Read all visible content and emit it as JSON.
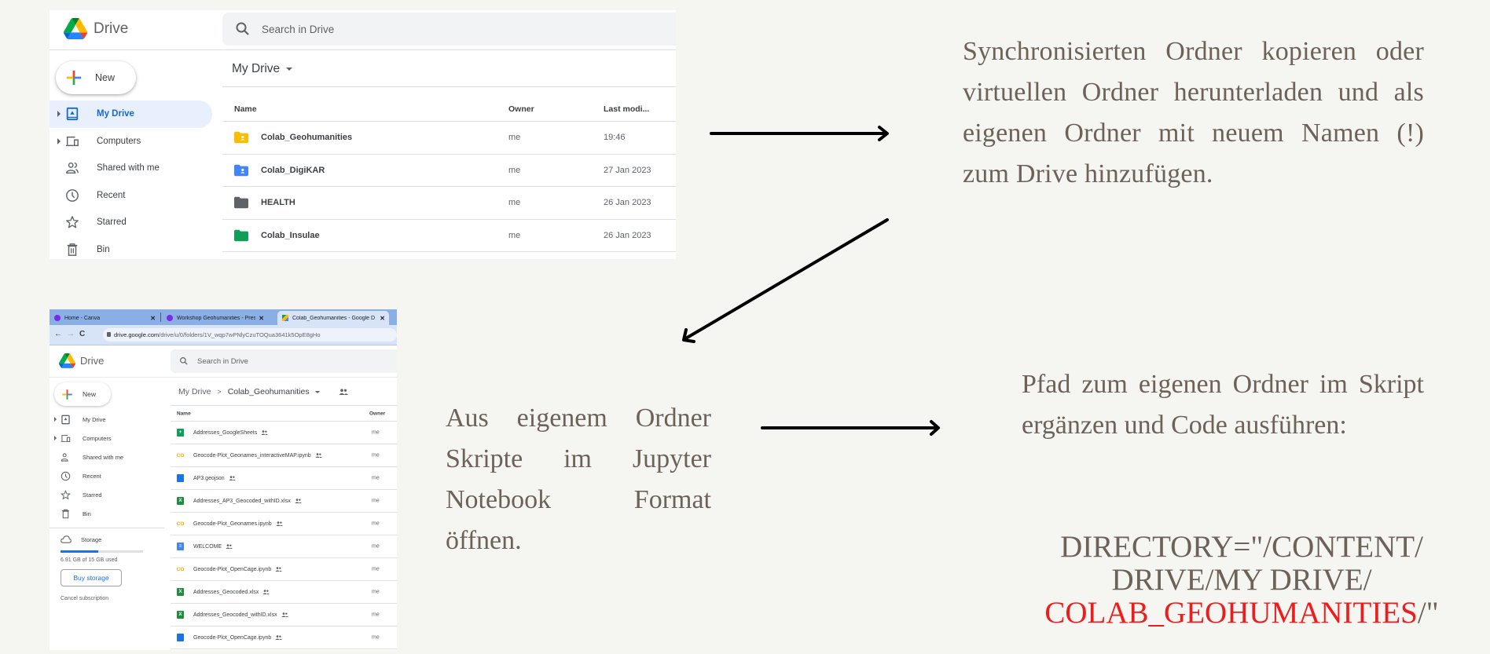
{
  "top_screenshot": {
    "app_name": "Drive",
    "search_placeholder": "Search in Drive",
    "new_label": "New",
    "nav": [
      {
        "label": "My Drive",
        "icon": "my-drive-icon",
        "active": true,
        "expandable": true
      },
      {
        "label": "Computers",
        "icon": "computers-icon",
        "active": false,
        "expandable": true
      },
      {
        "label": "Shared with me",
        "icon": "shared-icon",
        "active": false,
        "expandable": false
      },
      {
        "label": "Recent",
        "icon": "clock-icon",
        "active": false,
        "expandable": false
      },
      {
        "label": "Starred",
        "icon": "star-icon",
        "active": false,
        "expandable": false
      },
      {
        "label": "Bin",
        "icon": "trash-icon",
        "active": false,
        "expandable": false
      }
    ],
    "location": "My Drive",
    "columns": {
      "name": "Name",
      "owner": "Owner",
      "modified": "Last modi..."
    },
    "rows": [
      {
        "name": "Colab_Geohumanities",
        "owner": "me",
        "modified": "19:46",
        "icon": "shared-folder-icon",
        "color": "#fbbc04"
      },
      {
        "name": "Colab_DigiKAR",
        "owner": "me",
        "modified": "27 Jan 2023",
        "icon": "shared-folder-icon",
        "color": "#4285f4"
      },
      {
        "name": "HEALTH",
        "owner": "me",
        "modified": "26 Jan 2023",
        "icon": "folder-icon",
        "color": "#5f6368"
      },
      {
        "name": "Colab_Insulae",
        "owner": "me",
        "modified": "26 Jan 2023",
        "icon": "folder-icon",
        "color": "#0f9d58"
      }
    ]
  },
  "bottom_screenshot": {
    "tabs": [
      {
        "title": "Home - Canva",
        "favicon": "canva-icon",
        "active": false
      },
      {
        "title": "Workshop Geohumanities - Prese",
        "favicon": "canva-icon",
        "active": false
      },
      {
        "title": "Colab_Geohumanities - Google D",
        "favicon": "drive-icon",
        "active": true
      }
    ],
    "url_host": "drive.google.com",
    "url_path": "/drive/u/0/folders/1V_wqp7wPNlyCzuTOQua3641k5OpE8gHo",
    "app_name": "Drive",
    "search_placeholder": "Search in Drive",
    "new_label": "New",
    "nav": [
      {
        "label": "My Drive",
        "expandable": true
      },
      {
        "label": "Computers",
        "expandable": true
      },
      {
        "label": "Shared with me",
        "expandable": false
      },
      {
        "label": "Recent",
        "expandable": false
      },
      {
        "label": "Starred",
        "expandable": false
      },
      {
        "label": "Bin",
        "expandable": false
      }
    ],
    "storage": {
      "label": "Storage",
      "used_fraction": 0.46,
      "used_text": "6.91 GB of 15 GB used",
      "buy_label": "Buy storage",
      "cancel_label": "Cancel subscription"
    },
    "breadcrumb": {
      "root": "My Drive",
      "separator": ">",
      "current": "Colab_Geohumanities"
    },
    "columns": {
      "name": "Name",
      "owner": "Owner"
    },
    "rows": [
      {
        "name": "Addresses_GoogleSheets",
        "owner": "me",
        "type": "sheets"
      },
      {
        "name": "Geocode-Plot_Geonames_interactiveMAP.ipynb",
        "owner": "me",
        "type": "colab"
      },
      {
        "name": "AP3.geojson",
        "owner": "me",
        "type": "file"
      },
      {
        "name": "Addresses_AP3_Geocoded_withID.xlsx",
        "owner": "me",
        "type": "excel"
      },
      {
        "name": "Geocode-Plot_Geonames.ipynb",
        "owner": "me",
        "type": "colab"
      },
      {
        "name": "WELCOME",
        "owner": "me",
        "type": "docs"
      },
      {
        "name": "Geocode-Plot_OpenCage.ipynb",
        "owner": "me",
        "type": "colab"
      },
      {
        "name": "Addresses_Geocoded.xlsx",
        "owner": "me",
        "type": "excel"
      },
      {
        "name": "Addresses_Geocoded_withID.xlsx",
        "owner": "me",
        "type": "excel"
      },
      {
        "name": "Geocode-Plot_OpenCage.ipynb",
        "owner": "me",
        "type": "file"
      }
    ]
  },
  "notes": {
    "step1": "Synchronisierten Ordner kopieren oder virtuellen Ordner herunterladen und als eigenen Ordner mit neuem Namen (!) zum Drive hinzufügen.",
    "step2": "Aus eigenem Ordner Skripte im Jupyter Notebook Format öffnen.",
    "step3": "Pfad zum eigenen Ordner im Skript ergänzen und Code ausführen:",
    "code_line1": "DIRECTORY=\"/CONTENT/",
    "code_line2": "DRIVE/MY DRIVE/",
    "code_highlight": "COLAB_GEOHUMANITIES",
    "code_end": "/\""
  },
  "colors": {
    "background": "#f5f5f1",
    "text": "#6c6259",
    "highlight": "#ee1c1c",
    "drive_blue": "#1a73e8"
  }
}
